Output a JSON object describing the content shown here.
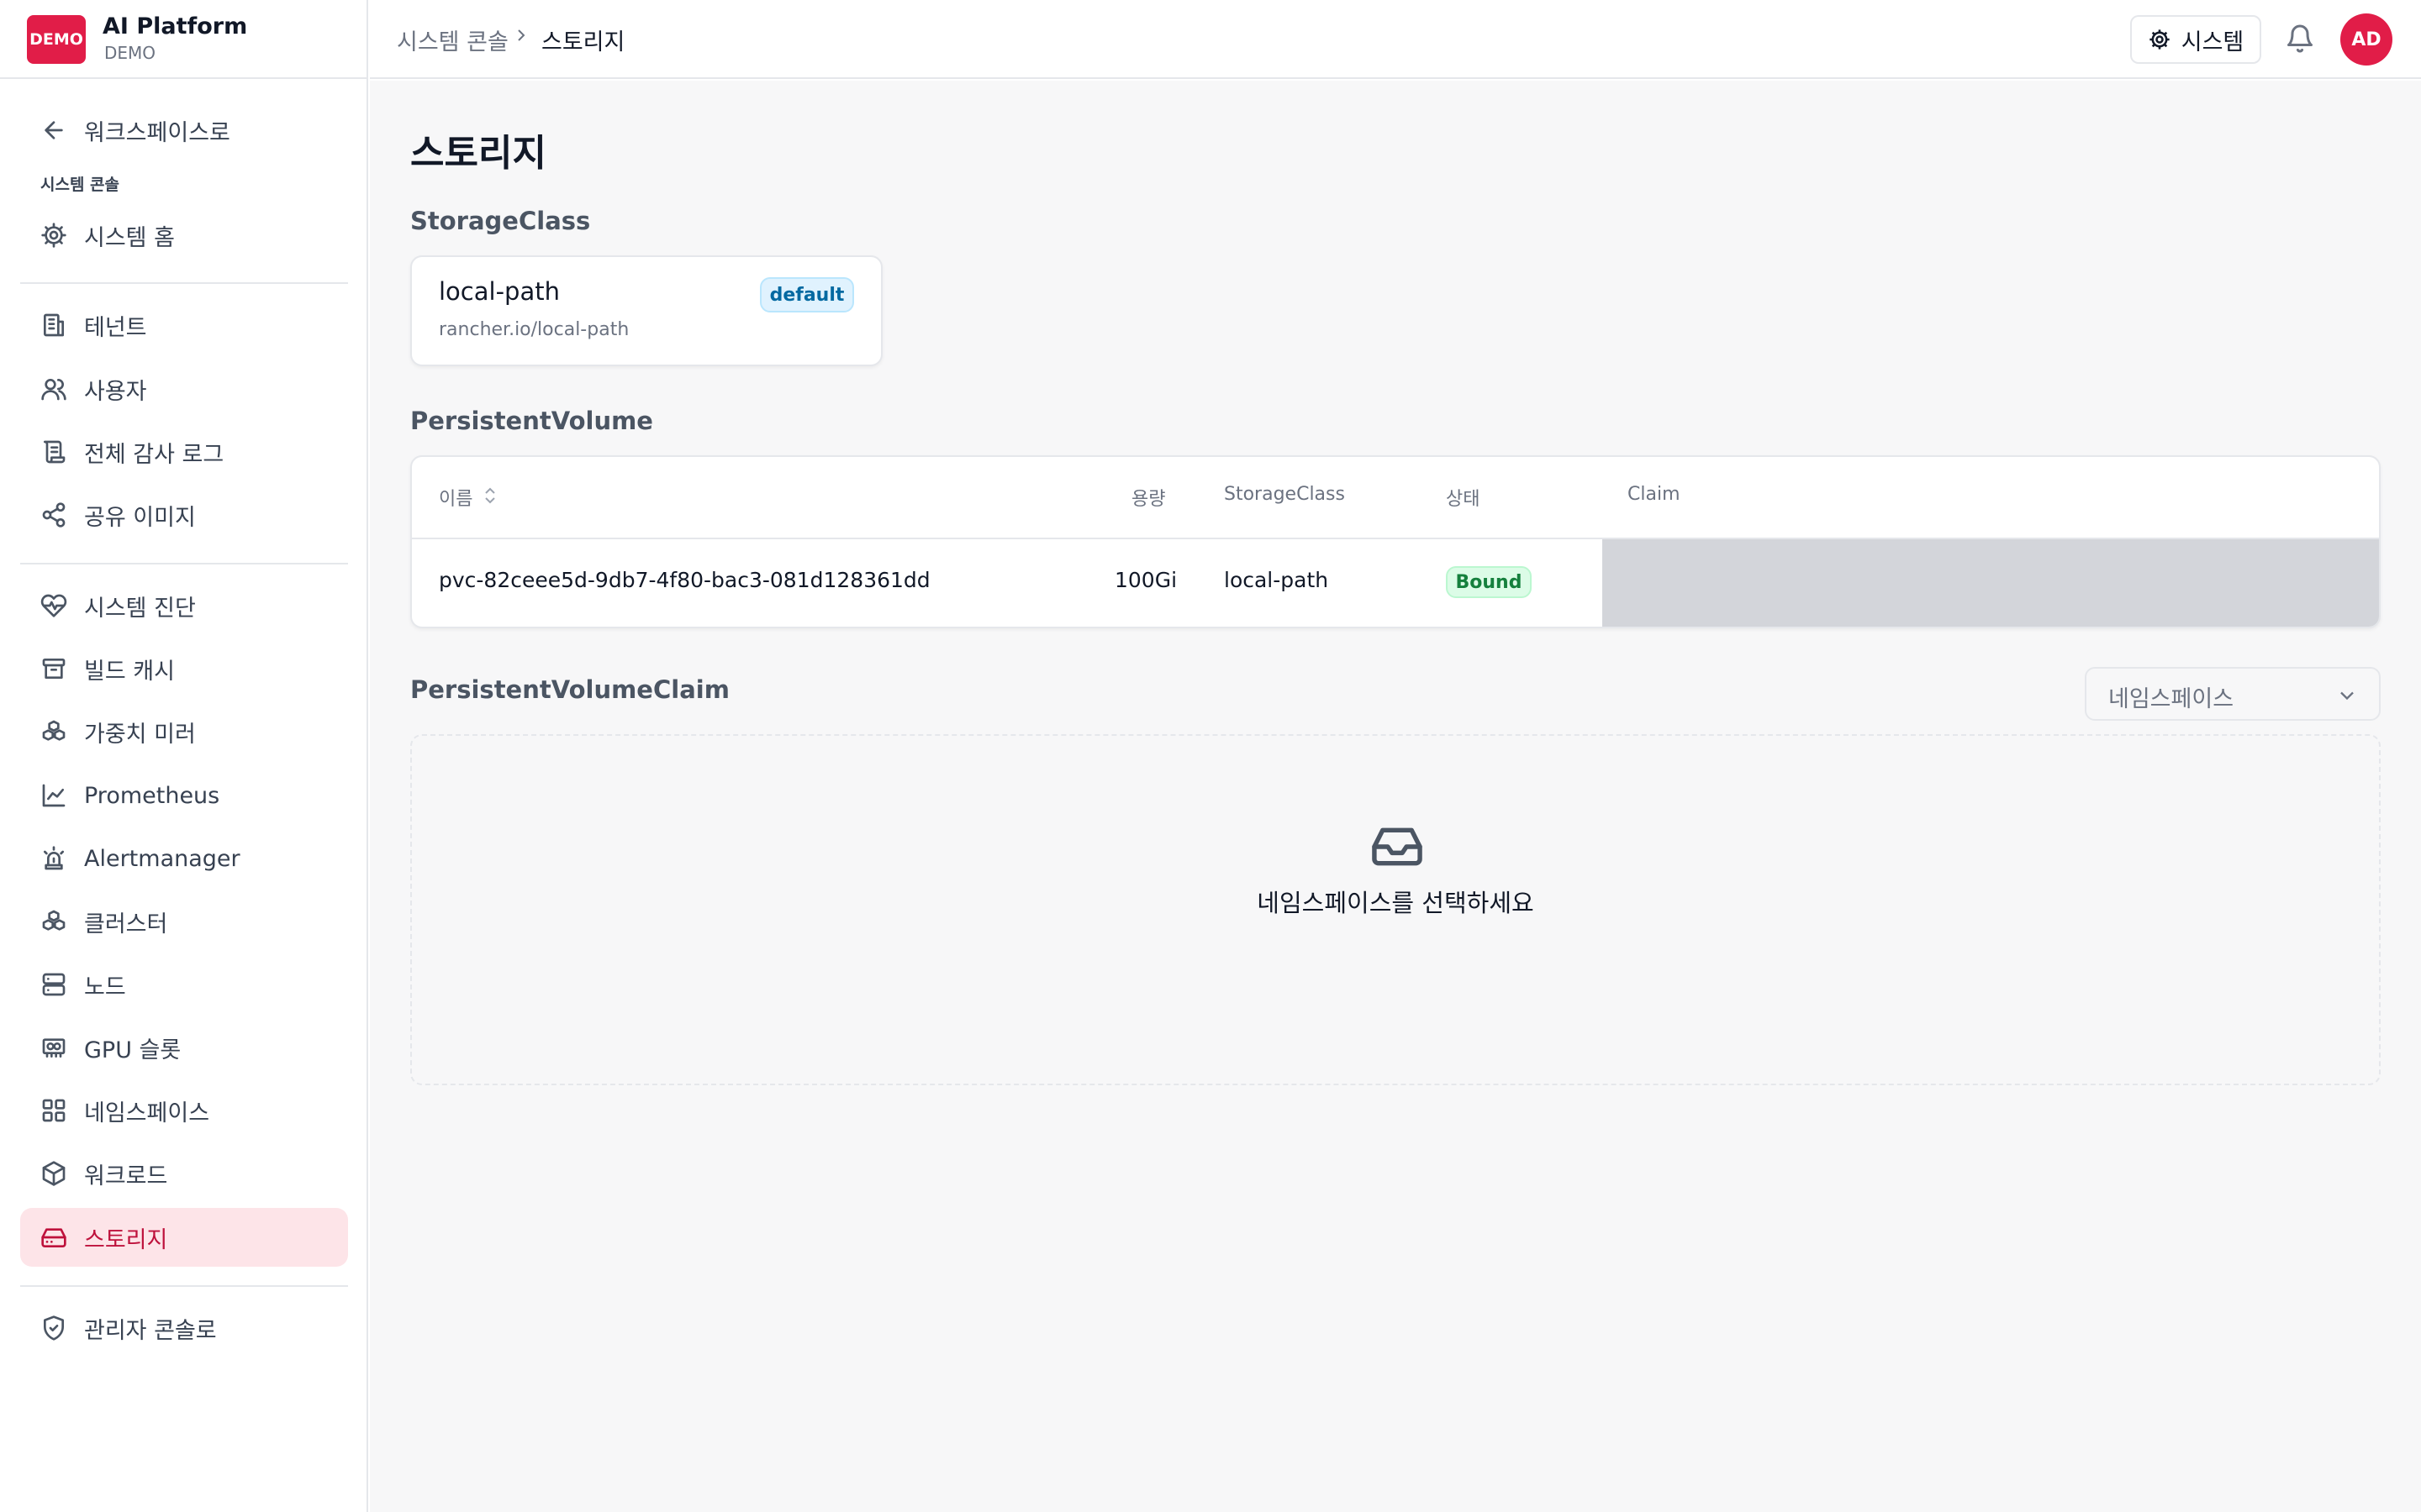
{
  "brand": {
    "badge": "DEMO",
    "title": "AI Platform",
    "subtitle": "DEMO"
  },
  "sidebar": {
    "back_label": "워크스페이스로",
    "section_label": "시스템 콘솔",
    "home_label": "시스템 홈",
    "group1": [
      "테넌트",
      "사용자",
      "전체 감사 로그",
      "공유 이미지"
    ],
    "group2": [
      "시스템 진단",
      "빌드 캐시",
      "가중치 미러",
      "Prometheus",
      "Alertmanager",
      "클러스터",
      "노드",
      "GPU 슬롯",
      "네임스페이스",
      "워크로드",
      "스토리지"
    ],
    "admin_label": "관리자 콘솔로",
    "active": "스토리지"
  },
  "topbar": {
    "breadcrumb": [
      "시스템 콘솔",
      "스토리지"
    ],
    "system_button": "시스템",
    "avatar_initials": "AD"
  },
  "page": {
    "title": "스토리지"
  },
  "storage_class": {
    "section_title": "StorageClass",
    "name": "local-path",
    "provisioner": "rancher.io/local-path",
    "badge": "default"
  },
  "persistent_volume": {
    "section_title": "PersistentVolume",
    "columns": [
      "이름",
      "용량",
      "StorageClass",
      "상태",
      "Claim"
    ],
    "rows": [
      {
        "name": "pvc-82ceee5d-9db7-4f80-bac3-081d128361dd",
        "capacity": "100Gi",
        "storage_class": "local-path",
        "status": "Bound",
        "claim": ""
      }
    ]
  },
  "persistent_volume_claim": {
    "section_title": "PersistentVolumeClaim",
    "namespace_select": "네임스페이스",
    "empty_message": "네임스페이스를 선택하세요"
  },
  "colors": {
    "brand": "#e11d48",
    "active_bg": "#fde4e8",
    "active_fg": "#be123c",
    "bound_fg": "#15803d",
    "default_fg": "#0369a1"
  }
}
